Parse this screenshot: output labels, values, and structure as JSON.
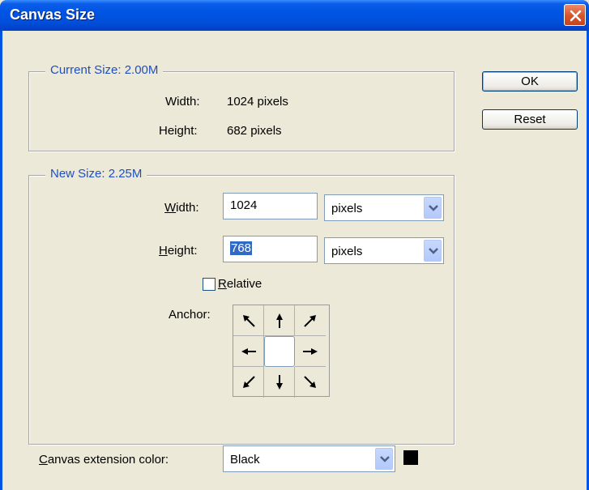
{
  "window": {
    "title": "Canvas Size"
  },
  "current_size": {
    "legend": "Current Size: 2.00M",
    "width_label": "Width:",
    "width_value": "1024 pixels",
    "height_label": "Height:",
    "height_value": "682 pixels"
  },
  "new_size": {
    "legend": "New Size: 2.25M",
    "width_label_mnemonic": "W",
    "width_label_rest": "idth:",
    "width_value": "1024",
    "width_unit": "pixels",
    "height_label_mnemonic": "H",
    "height_label_rest": "eight:",
    "height_value": "768",
    "height_unit": "pixels",
    "relative_mnemonic": "R",
    "relative_rest": "elative",
    "relative_checked": false,
    "anchor_label": "Anchor:"
  },
  "buttons": {
    "ok": "OK",
    "reset": "Reset"
  },
  "extension": {
    "label_mnemonic": "C",
    "label_rest": "anvas extension color:",
    "value": "Black",
    "swatch_color": "#000000"
  },
  "icons": {
    "close": "close-icon",
    "dropdown": "chevron-down-icon",
    "anchor_arrows": [
      "arrow-up-left-icon",
      "arrow-up-icon",
      "arrow-up-right-icon",
      "arrow-left-icon",
      "anchor-center",
      "arrow-right-icon",
      "arrow-down-left-icon",
      "arrow-down-icon",
      "arrow-down-right-icon"
    ]
  },
  "colors": {
    "titlebar": "#0054e3",
    "legend_text": "#1f4fbf",
    "selection": "#316ac5"
  }
}
